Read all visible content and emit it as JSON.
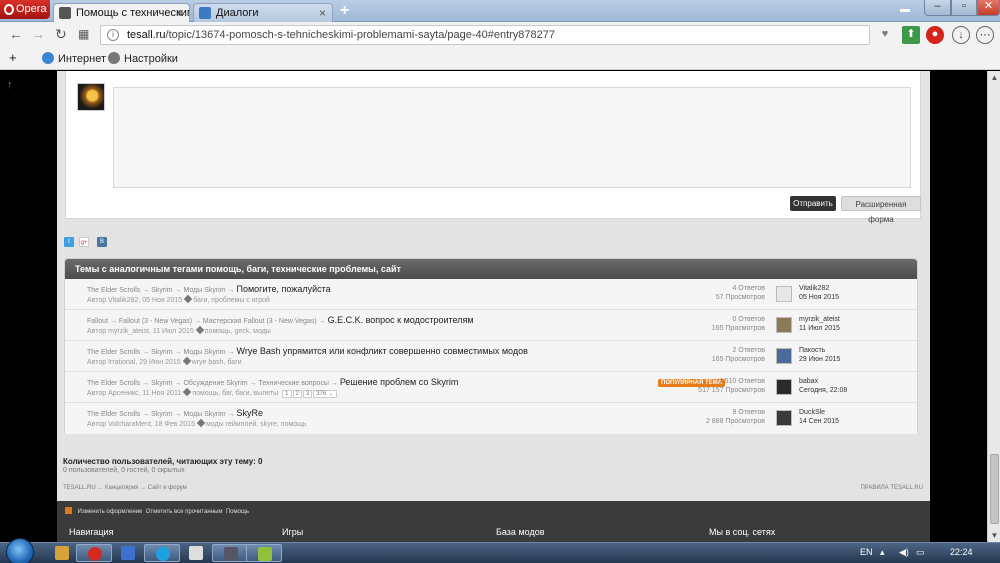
{
  "browser": {
    "menu_label": "Opera",
    "tabs": [
      {
        "label": "Помощь с техническим",
        "active": true
      },
      {
        "label": "Диалоги",
        "active": false
      }
    ],
    "url_host": "tesall.ru",
    "url_path": "/topic/13674-pomosch-s-tehnicheskimi-problemami-sayta/page-40#entry878277",
    "bookmarks": [
      {
        "label": "Интернет",
        "icon": "globe-icon"
      },
      {
        "label": "Настройки",
        "icon": "gear-icon"
      }
    ]
  },
  "reply": {
    "send_label": "Отправить",
    "advanced_label": "Расширенная форма"
  },
  "similar": {
    "heading": "Темы с аналогичным тегами помощь, баги, технические проблемы, сайт",
    "rows": [
      {
        "crumbs": "The Elder Scrolls → Skyrim → Моды Skyrim →",
        "title": "Помогите, пожалуйста",
        "author": "Автор Vitalik282, 05 Ноя 2015",
        "tags": "баги, проблемы с игрой",
        "replies": "4 Ответов",
        "views": "57 Просмотров",
        "last_user": "Vitalik282",
        "last_date": "05 Ноя 2015",
        "avatar_color": "#e8e8e8"
      },
      {
        "crumbs": "Fallout → Fallout (3 - New Vegas) → Мастерская Fallout (3 - New Vegas) →",
        "title": "G.E.C.K. вопрос к модостроителям",
        "author": "Автор myrzik_ateist, 11 Июл 2015",
        "tags": "помощь, geck, моды",
        "replies": "0 Ответов",
        "views": "165 Просмотров",
        "last_user": "myrzik_ateist",
        "last_date": "11 Июл 2015",
        "avatar_color": "#8a7a5a"
      },
      {
        "crumbs": "The Elder Scrolls → Skyrim → Моды Skyrim →",
        "title": "Wrye Bash упрямится или конфликт совершенно совместимых модов",
        "author": "Автор Irrational, 29 Июн 2015",
        "tags": "wrye bash, баги",
        "replies": "2 Ответов",
        "views": "165 Просмотров",
        "last_user": "Пакость",
        "last_date": "29 Июн 2015",
        "avatar_color": "#4a6a9a"
      },
      {
        "crumbs": "The Elder Scrolls → Skyrim → Обсуждение Skyrim → Технические вопросы →",
        "title": "Решение проблем со Skyrim",
        "author": "Автор Арсеникс, 11 Ноя 2011",
        "tags": "помощь, баг, баги, вылеты",
        "pages": [
          "1",
          "2",
          "3",
          "376 →"
        ],
        "badge": "ПОПУЛЯРНАЯ ТЕМА",
        "replies": "7 510 Ответов",
        "views": "517 157 Просмотров",
        "last_user": "babax",
        "last_date": "Сегодня, 22:08",
        "avatar_color": "#2a2a2a"
      },
      {
        "crumbs": "The Elder Scrolls → Skyrim → Моды Skyrim →",
        "title": "SkyRe",
        "author": "Автор VolcharaMent, 18 Фев 2015",
        "tags": "моды геймплей, skyre, помощь",
        "replies": "9 Ответов",
        "views": "2 888 Просмотров",
        "last_user": "DuckSle",
        "last_date": "14 Сен 2015",
        "avatar_color": "#3a3a3a"
      }
    ]
  },
  "readers": {
    "title": "Количество пользователей, читающих эту тему: 0",
    "detail": "0 пользователей, 0 гостей, 0 скрытых"
  },
  "footer": {
    "breadcrumbs": "TESALL.RU → Канцелярия → Сайт и форум",
    "rules": "ПРАВИЛА TESALL.RU",
    "links": [
      "Изменить оформление",
      "Отметить все прочитанным",
      "Помощь"
    ],
    "columns": [
      "Навигация",
      "Игры",
      "База модов",
      "Мы в соц. сетях"
    ]
  },
  "taskbar": {
    "lang": "EN",
    "time": "22:24"
  }
}
